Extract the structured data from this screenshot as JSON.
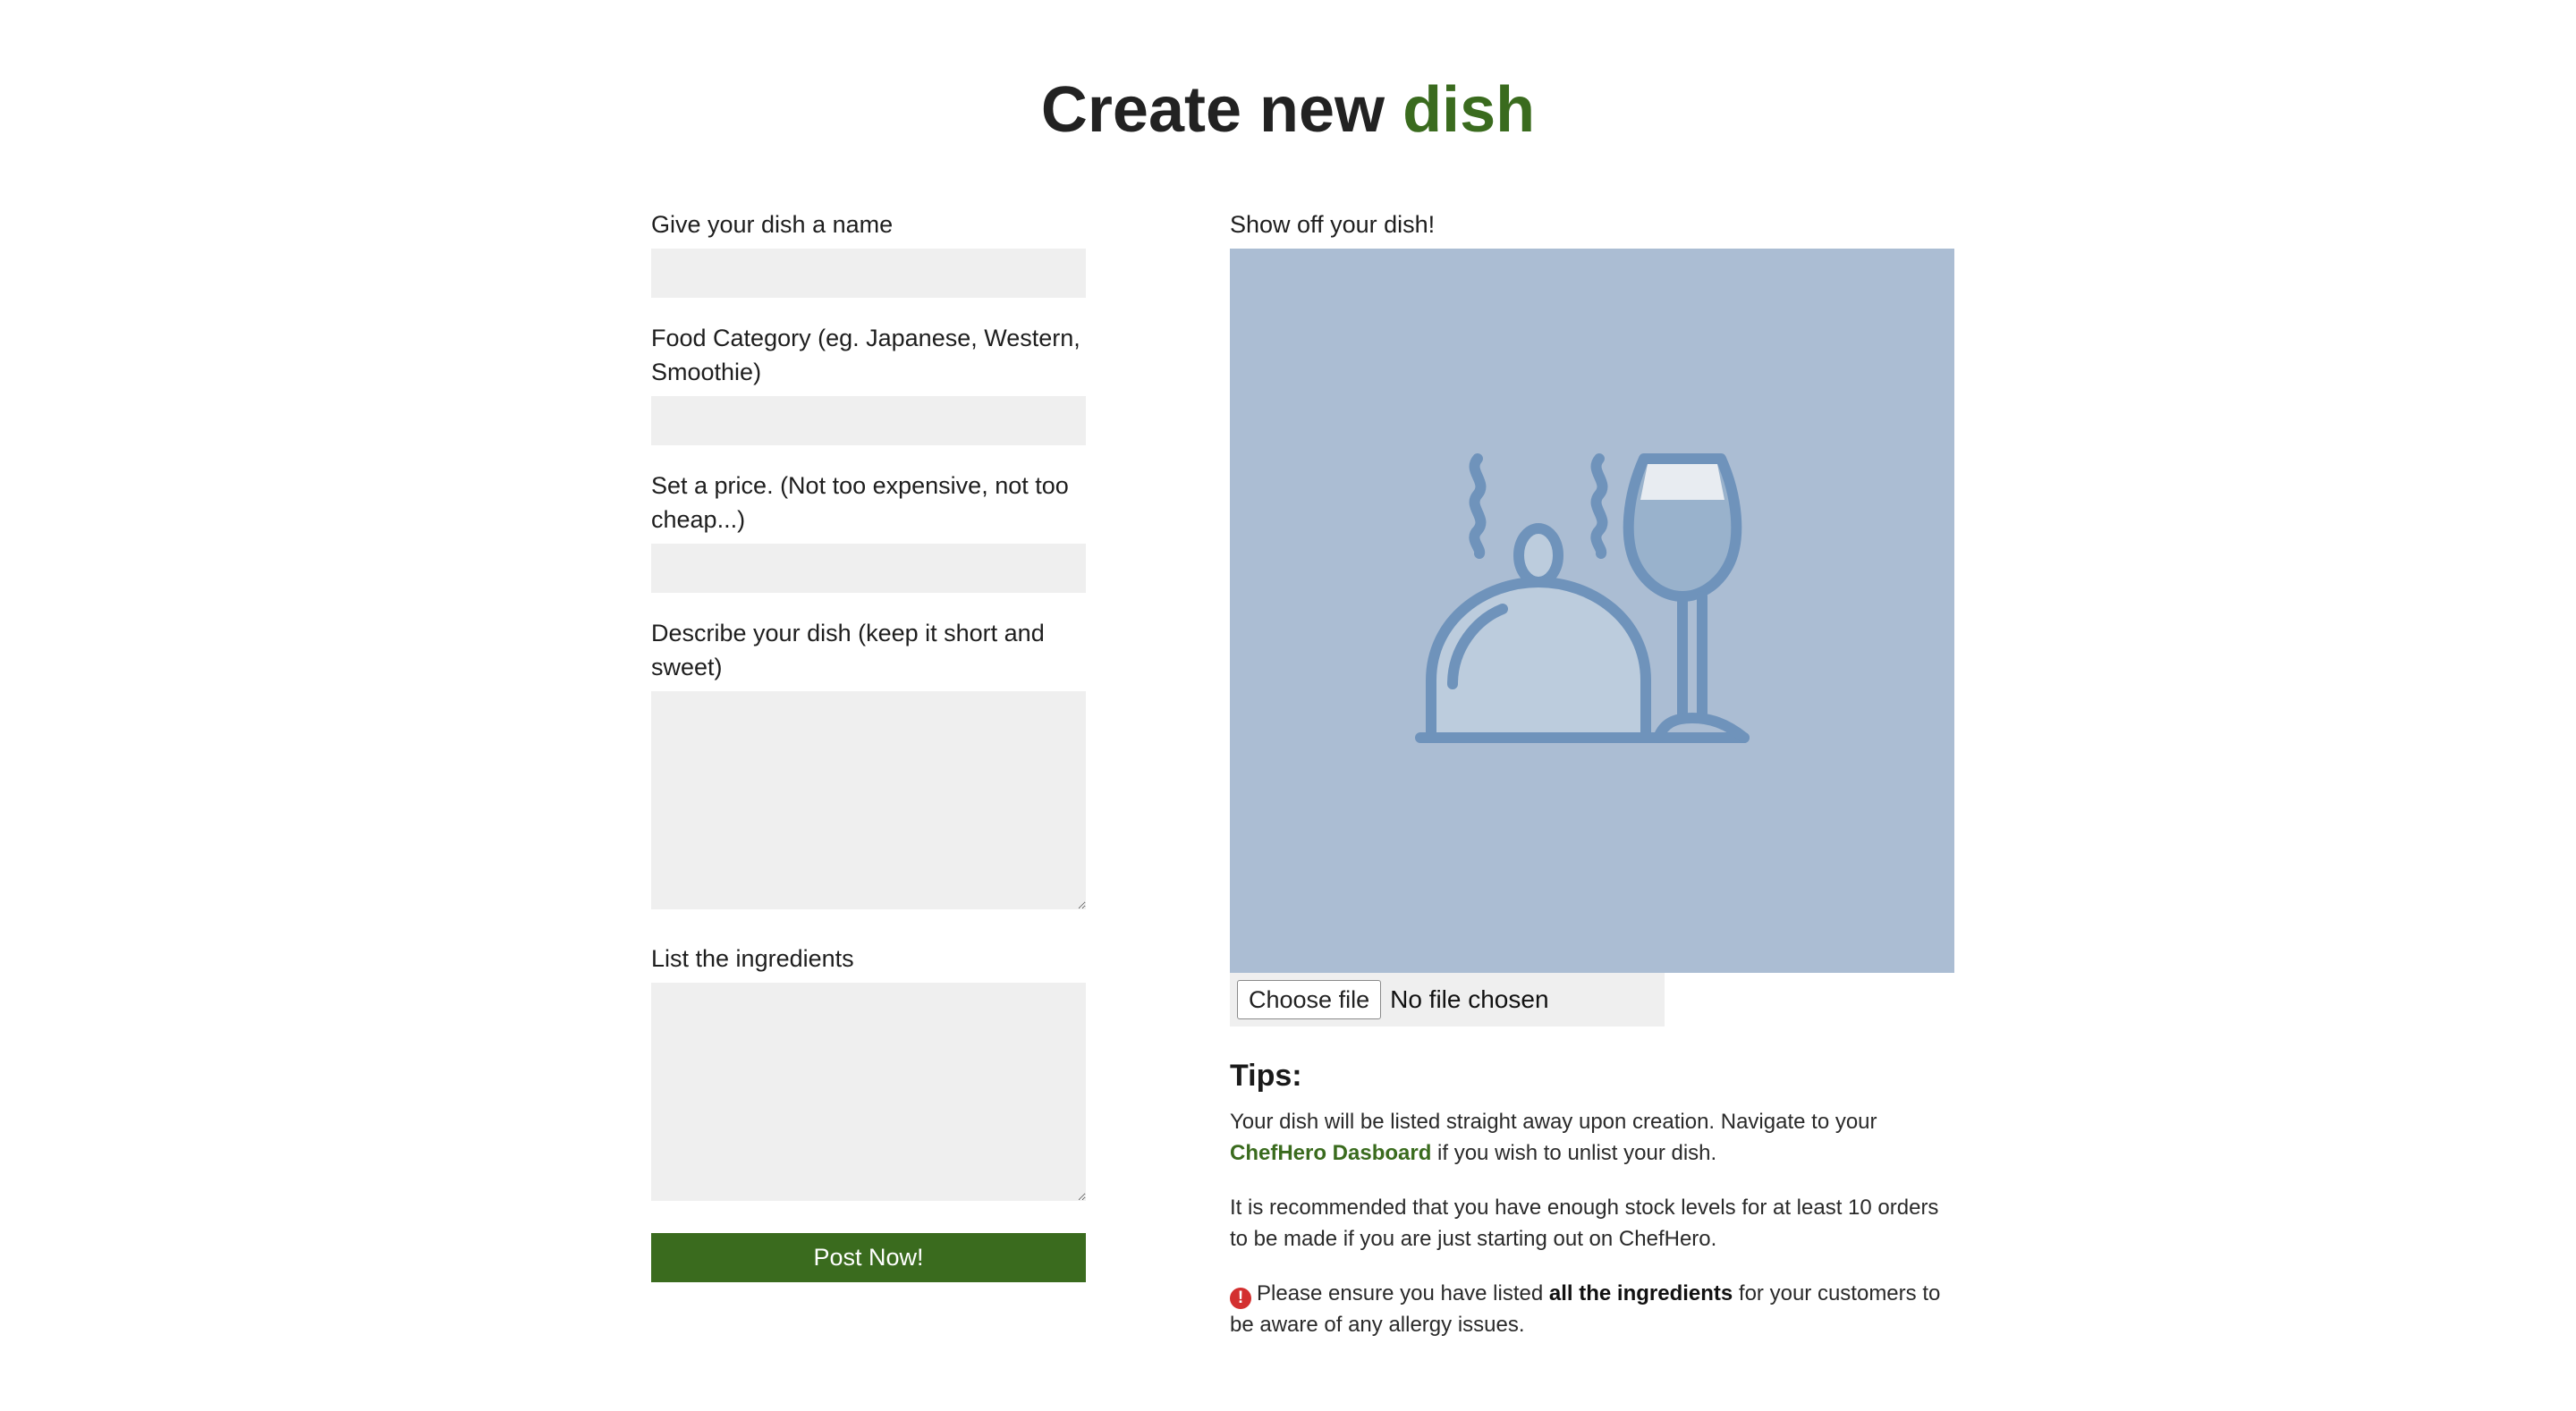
{
  "title": {
    "main": "Create new",
    "accent": "dish"
  },
  "form": {
    "name_label": "Give your dish a name",
    "name_value": "",
    "category_label": "Food Category (eg. Japanese, Western, Smoothie)",
    "category_value": "",
    "price_label": "Set a price. (Not too expensive, not too cheap...)",
    "price_value": "",
    "description_label": "Describe your dish (keep it short and sweet)",
    "description_value": "",
    "ingredients_label": "List the ingredients",
    "ingredients_value": "",
    "submit_label": "Post Now!"
  },
  "media": {
    "label": "Show off your dish!",
    "placeholder_icon": "dish-cloche-and-wine-glass-icon",
    "choose_file_label": "Choose file",
    "file_status": "No file chosen"
  },
  "tips": {
    "heading": "Tips:",
    "tip1_before": "Your dish will be listed straight away upon creation. Navigate to your ",
    "tip1_link": "ChefHero Dasboard",
    "tip1_after": " if you wish to unlist your dish.",
    "tip2": "It is recommended that you have enough stock levels for at least 10 orders to be made if you are just starting out on ChefHero.",
    "tip3_icon": "exclamation-icon",
    "tip3_before": "Please ensure you have listed ",
    "tip3_bold": "all the ingredients",
    "tip3_after": " for your customers to be aware of any allergy issues."
  },
  "colors": {
    "accent": "#3a6b1e",
    "image_bg": "#abbdd3",
    "icon_stroke": "#6f93bb",
    "input_bg": "#efefef",
    "warning": "#d32f2f"
  }
}
